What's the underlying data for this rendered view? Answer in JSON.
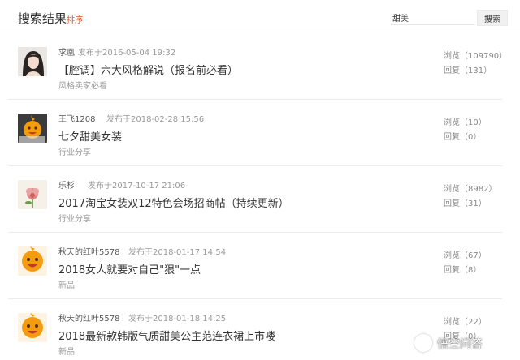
{
  "header": {
    "title": "搜索结果",
    "sort_label": "排序",
    "search_value": "甜美",
    "search_button": "搜索"
  },
  "results": [
    {
      "author": "求凰",
      "posted": "发布于2016-05-04 19:32",
      "title": "【腔调】六大风格解说（报名前必看）",
      "category": "风格卖家必看",
      "views": "浏览（109790）",
      "replies": "回复（131）",
      "avatar_icon": "woman-portrait-avatar"
    },
    {
      "author": "王飞1208",
      "posted": "发布于2018-02-28 15:56",
      "title": "七夕甜美女装",
      "category": "行业分享",
      "views": "浏览（10）",
      "replies": "回复（0）",
      "avatar_icon": "orange-mascot-avatar"
    },
    {
      "author": "乐杉",
      "posted": "发布于2017-10-17 21:06",
      "title": "2017淘宝女装双12特色会场招商帖（持续更新）",
      "category": "行业分享",
      "views": "浏览（8982）",
      "replies": "回复（31）",
      "avatar_icon": "flower-avatar"
    },
    {
      "author": "秋天的红叶5578",
      "posted": "发布于2018-01-17 14:54",
      "title": "2018女人就要对自己\"狠\"一点",
      "category": "新品",
      "views": "浏览（67）",
      "replies": "回复（8）",
      "avatar_icon": "orange-mascot-avatar"
    },
    {
      "author": "秋天的红叶5578",
      "posted": "发布于2018-01-18 14:25",
      "title": "2018最新款韩版气质甜美公主范连衣裙上市喽",
      "category": "新品",
      "views": "浏览（22）",
      "replies": "回复（0）",
      "avatar_icon": "orange-mascot-avatar"
    }
  ],
  "watermark": {
    "text": "悟空问答"
  },
  "colors": {
    "accent": "#e4521f",
    "mascot": "#f39c12"
  }
}
